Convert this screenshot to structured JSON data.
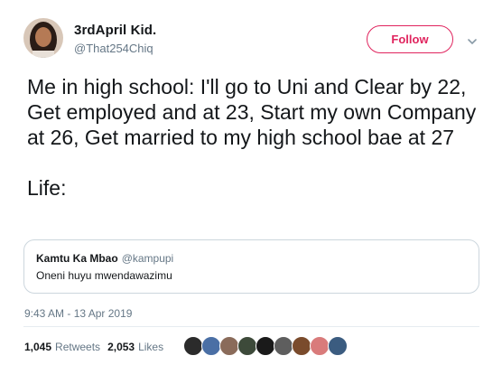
{
  "author": {
    "name": "3rdApril Kid.",
    "handle": "@That254Chiq",
    "avatar_icon": "profile-photo"
  },
  "follow_button": {
    "label": "Follow",
    "color": "#e0245e"
  },
  "menu_icon": "chevron-down-icon",
  "tweet": {
    "text": "Me in high school: I'll go to Uni and Clear by 22, Get employed and at 23, Start my own Company at 26, Get married to my high school bae at 27",
    "text_2": "Life:"
  },
  "quoted_tweet": {
    "author_name": "Kamtu Ka Mbao",
    "author_handle": "@kampupi",
    "text": "Oneni huyu mwendawazimu"
  },
  "timestamp": "9:43 AM - 13 Apr 2019",
  "stats": {
    "retweets_count": "1,045",
    "retweets_label": "Retweets",
    "likes_count": "2,053",
    "likes_label": "Likes"
  },
  "likers": [
    {
      "color": "#2b2b2b"
    },
    {
      "color": "#4a6fa5"
    },
    {
      "color": "#8a6b5a"
    },
    {
      "color": "#3d4a3a"
    },
    {
      "color": "#1a1a1a"
    },
    {
      "color": "#5e5e5e"
    },
    {
      "color": "#7a4b2c"
    },
    {
      "color": "#d97b7b"
    },
    {
      "color": "#3b5c80"
    }
  ]
}
